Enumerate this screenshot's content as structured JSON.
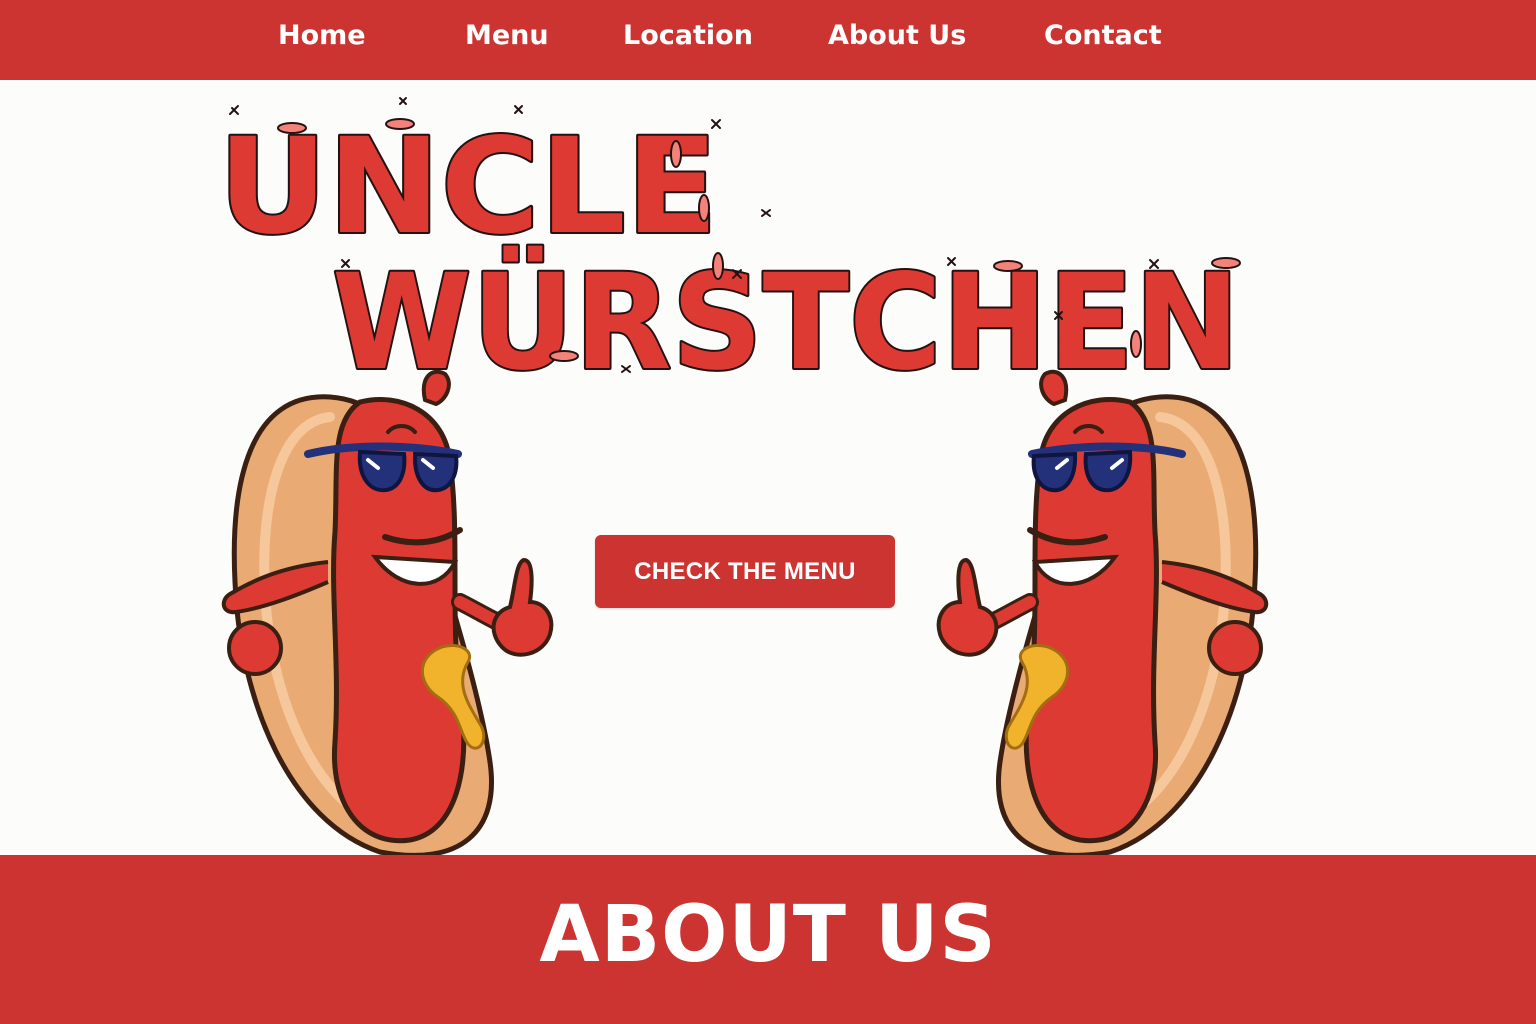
{
  "nav": {
    "items": [
      {
        "label": "Home"
      },
      {
        "label": "Menu"
      },
      {
        "label": "Location"
      },
      {
        "label": "About Us"
      },
      {
        "label": "Contact"
      }
    ]
  },
  "hero": {
    "logo_line1": "UNCLE",
    "logo_line2": "WÜRSTCHEN",
    "cta_label": "CHECK THE MENU"
  },
  "about": {
    "title": "ABOUT US"
  },
  "colors": {
    "brand_red": "#cc3431",
    "background": "#fcfcfa",
    "text_on_red": "#ffffff",
    "sausage_red": "#dd3a33",
    "bun": "#e9aa74",
    "mustard": "#f2b32c",
    "sunglasses": "#23307a"
  },
  "icons": {
    "mascot": "hot-dog-mascot-with-sunglasses"
  }
}
